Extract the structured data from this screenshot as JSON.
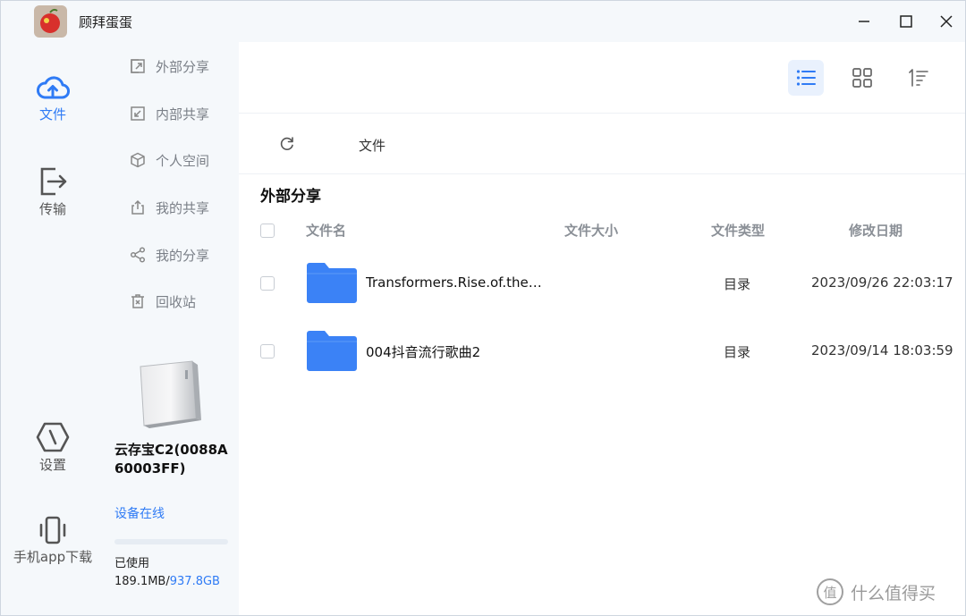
{
  "window": {
    "title": "顾拜蛋蛋"
  },
  "rail": {
    "items": [
      {
        "label": "文件",
        "icon": "cloud-icon",
        "active": true
      },
      {
        "label": "传输",
        "icon": "transfer-icon",
        "active": false
      },
      {
        "label": "设置",
        "icon": "settings-icon",
        "active": false
      },
      {
        "label": "手机app下载",
        "icon": "phone-icon",
        "active": false
      }
    ]
  },
  "sidebar": {
    "items": [
      {
        "label": "外部分享",
        "icon": "external-share-icon"
      },
      {
        "label": "内部共享",
        "icon": "internal-share-icon"
      },
      {
        "label": "个人空间",
        "icon": "cube-icon"
      },
      {
        "label": "我的共享",
        "icon": "upload-share-icon"
      },
      {
        "label": "我的分享",
        "icon": "share-nodes-icon"
      },
      {
        "label": "回收站",
        "icon": "trash-icon"
      }
    ]
  },
  "device": {
    "name": "云存宝C2(0088A60003FF)",
    "status": "设备在线",
    "used_label": "已使用",
    "used": "189.1MB",
    "separator": "/",
    "total": "937.8GB",
    "usage_fraction": 0.0002
  },
  "toolbar": {
    "views": [
      "list-view-icon",
      "grid-view-icon",
      "sort-icon"
    ],
    "active_view": "list-view-icon"
  },
  "breadcrumb": {
    "current": "文件"
  },
  "section": {
    "title": "外部分享"
  },
  "table": {
    "headers": {
      "name": "文件名",
      "size": "文件大小",
      "type": "文件类型",
      "date": "修改日期"
    },
    "rows": [
      {
        "name": "Transformers.Rise.of.the…",
        "size": "",
        "type": "目录",
        "date": "2023/09/26 22:03:17"
      },
      {
        "name": "004抖音流行歌曲2",
        "size": "",
        "type": "目录",
        "date": "2023/09/14 18:03:59"
      }
    ]
  },
  "watermark": {
    "text": "什么值得买",
    "icon_glyph": "值"
  },
  "colors": {
    "accent": "#2f7bf5",
    "folder": "#3b82f6",
    "sidebar_bg": "#f5f8fb"
  }
}
